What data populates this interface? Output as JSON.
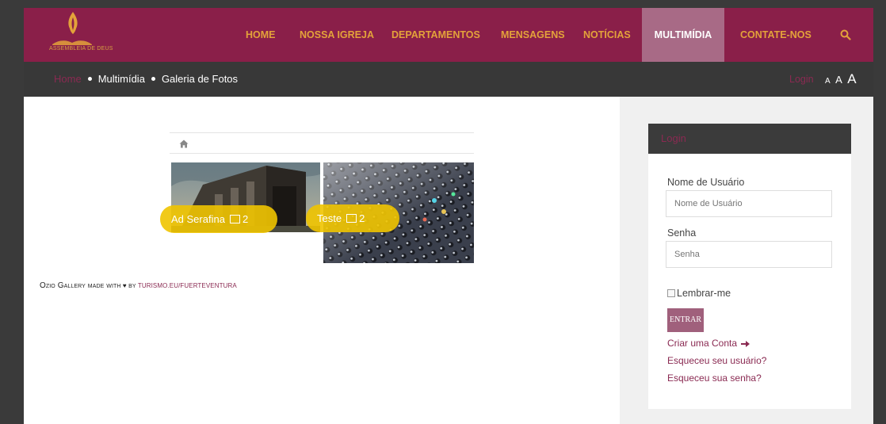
{
  "logo": {
    "text": "ASSEMBLEIA DE DEUS"
  },
  "nav": {
    "items": [
      {
        "label": "HOME",
        "active": false
      },
      {
        "label": "NOSSA IGREJA",
        "active": false
      },
      {
        "label": "DEPARTAMENTOS",
        "active": false
      },
      {
        "label": "MENSAGENS",
        "active": false
      },
      {
        "label": "NOTÍCIAS",
        "active": false
      },
      {
        "label": "MULTIMÍDIA",
        "active": true
      },
      {
        "label": "CONTATE-NOS",
        "active": false
      }
    ],
    "search_icon": "search-icon"
  },
  "breadcrumb": {
    "home": "Home",
    "items": [
      "Multimídia",
      "Galeria de Fotos"
    ]
  },
  "header_tools": {
    "login": "Login",
    "font_sizes": [
      "A",
      "A",
      "A"
    ]
  },
  "gallery": {
    "home_icon": "home-icon",
    "albums": [
      {
        "title": "Ad Serafina",
        "count": "2"
      },
      {
        "title": "Teste",
        "count": "2"
      }
    ],
    "credit": {
      "prefix": "Ozio Gallery made with",
      "heart": "♥",
      "by": "by",
      "link": "turismo.eu/fuerteventura"
    }
  },
  "login": {
    "title": "Login",
    "username_label": "Nome de Usuário",
    "username_placeholder": "Nome de Usuário",
    "password_label": "Senha",
    "password_placeholder": "Senha",
    "remember": "Lembrar-me",
    "submit": "ENTRAR",
    "create_account": "Criar uma Conta",
    "forgot_user": "Esqueceu seu usuário?",
    "forgot_pass": "Esqueceu sua senha?"
  },
  "colors": {
    "brand": "#8a1f49",
    "nav_text": "#e3a23a",
    "active_nav": "#a86a86",
    "label_yellow": "#f0c400"
  }
}
